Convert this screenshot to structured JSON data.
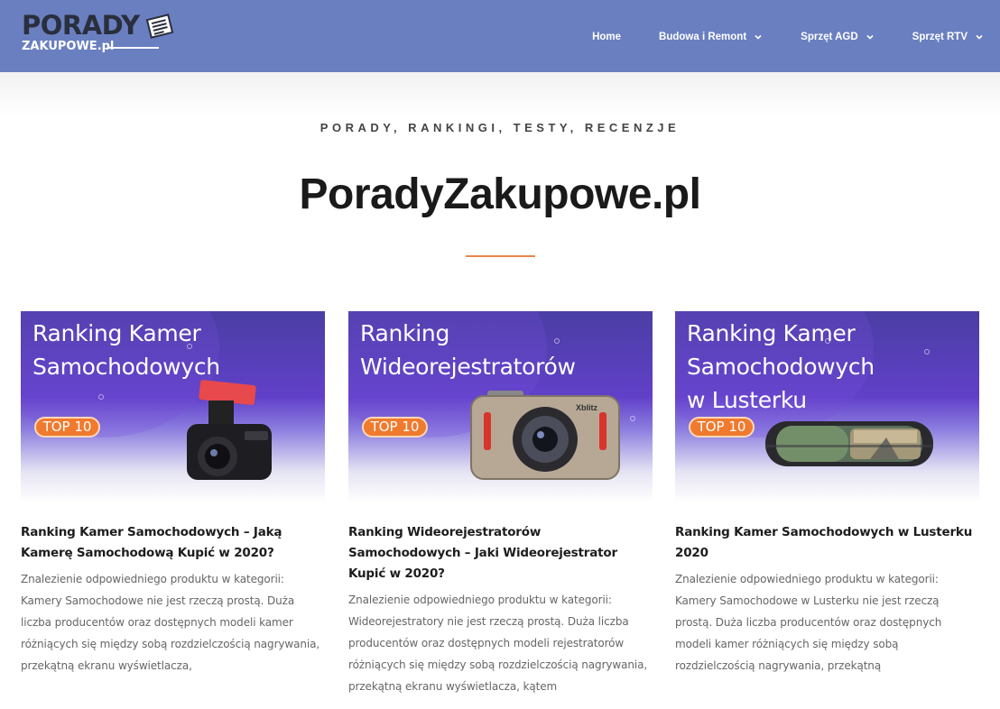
{
  "header": {
    "logo": {
      "top": "PORADY",
      "bottom": "ZAKUPOWE.pl"
    },
    "nav": [
      {
        "label": "Home",
        "has_dropdown": false
      },
      {
        "label": "Budowa i Remont",
        "has_dropdown": true
      },
      {
        "label": "Sprzęt AGD",
        "has_dropdown": true
      },
      {
        "label": "Sprzęt RTV",
        "has_dropdown": true
      }
    ]
  },
  "hero": {
    "tagline": "PORADY, RANKINGI, TESTY, RECENZJE",
    "title": "PoradyZakupowe.pl",
    "accent_color": "#e8864b"
  },
  "colors": {
    "header_bg": "#6a7fc0",
    "badge": "#f07a2e"
  },
  "posts": [
    {
      "image_lines": [
        "Ranking Kamer",
        "Samochodowych"
      ],
      "badge": "TOP 10",
      "title": "Ranking Kamer Samochodowych – Jaką Kamerę Samochodową Kupić w 2020?",
      "excerpt": "Znalezienie odpowiedniego produktu w kategorii: Kamery Samochodowe nie jest rzeczą prostą. Duża liczba producentów oraz dostępnych modeli kamer różniących się między sobą rozdzielczością nagrywania, przekątną ekranu wyświetlacza,"
    },
    {
      "image_lines": [
        "Ranking",
        "Wideorejestratorów"
      ],
      "badge": "TOP 10",
      "product_label": "Xblitz",
      "title": "Ranking Wideorejestratorów Samochodowych – Jaki Wideorejestrator Kupić w 2020?",
      "excerpt": "Znalezienie odpowiedniego produktu w kategorii: Wideorejestratory nie jest rzeczą prostą. Duża liczba producentów oraz dostępnych modeli rejestratorów różniących się między sobą rozdzielczością nagrywania, przekątną ekranu wyświetlacza, kątem"
    },
    {
      "image_lines": [
        "Ranking Kamer",
        "Samochodowych",
        "w Lusterku"
      ],
      "badge": "TOP 10",
      "title": "Ranking Kamer Samochodowych w Lusterku 2020",
      "excerpt": "Znalezienie odpowiedniego produktu w kategorii: Kamery Samochodowe w Lusterku nie jest rzeczą prostą. Duża liczba producentów oraz dostępnych modeli kamer różniących się między sobą rozdzielczością nagrywania, przekątną"
    }
  ]
}
